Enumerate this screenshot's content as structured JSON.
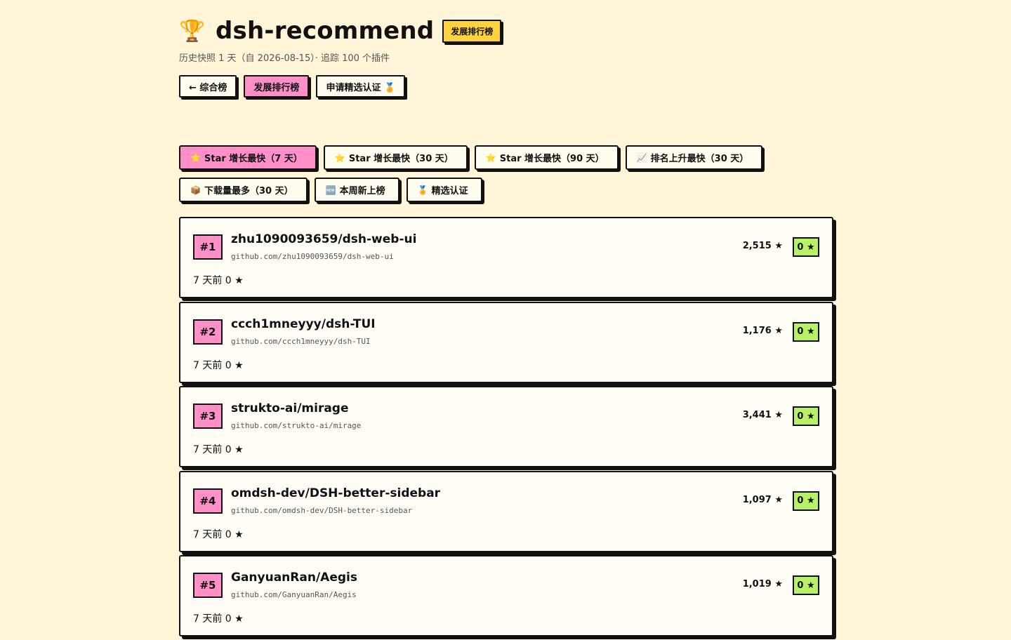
{
  "header": {
    "trophy_icon": "🏆",
    "title": "dsh-recommend",
    "badge": "发展排行榜",
    "subtitle": "历史快照 1 天（自 2026-08-15）· 追踪 100 个插件"
  },
  "nav": {
    "back": "← 综合榜",
    "growth": "发展排行榜",
    "apply": "申请精选认证 🏅"
  },
  "filters": {
    "row1": [
      {
        "icon": "⭐",
        "label": "Star 增长最快（7 天）",
        "active": true
      },
      {
        "icon": "⭐",
        "label": "Star 增长最快（30 天）",
        "active": false
      },
      {
        "icon": "⭐",
        "label": "Star 增长最快（90 天）",
        "active": false
      },
      {
        "icon": "📈",
        "label": "排名上升最快（30 天）",
        "active": false
      }
    ],
    "row2": [
      {
        "icon": "📦",
        "label": "下载量最多（30 天）",
        "active": false
      },
      {
        "icon": "🆕",
        "label": "本周新上榜",
        "active": false
      },
      {
        "icon": "🏅",
        "label": "精选认证",
        "active": false
      }
    ]
  },
  "items": [
    {
      "rank": "#1",
      "repo": "zhu1090093659/dsh-web-ui",
      "url": "github.com/zhu1090093659/dsh-web-ui",
      "stars": "2,515 ★",
      "gain": "0 ★",
      "note": "7 天前 0 ★"
    },
    {
      "rank": "#2",
      "repo": "ccch1mneyyy/dsh-TUI",
      "url": "github.com/ccch1mneyyy/dsh-TUI",
      "stars": "1,176 ★",
      "gain": "0 ★",
      "note": "7 天前 0 ★"
    },
    {
      "rank": "#3",
      "repo": "strukto-ai/mirage",
      "url": "github.com/strukto-ai/mirage",
      "stars": "3,441 ★",
      "gain": "0 ★",
      "note": "7 天前 0 ★"
    },
    {
      "rank": "#4",
      "repo": "omdsh-dev/DSH-better-sidebar",
      "url": "github.com/omdsh-dev/DSH-better-sidebar",
      "stars": "1,097 ★",
      "gain": "0 ★",
      "note": "7 天前 0 ★"
    },
    {
      "rank": "#5",
      "repo": "GanyuanRan/Aegis",
      "url": "github.com/GanyuanRan/Aegis",
      "stars": "1,019 ★",
      "gain": "0 ★",
      "note": "7 天前 0 ★"
    }
  ],
  "colors": {
    "background": "#fff5d9",
    "accent_pink": "#ff8fc7",
    "accent_yellow": "#ffd23f",
    "accent_green": "#b8f068"
  }
}
